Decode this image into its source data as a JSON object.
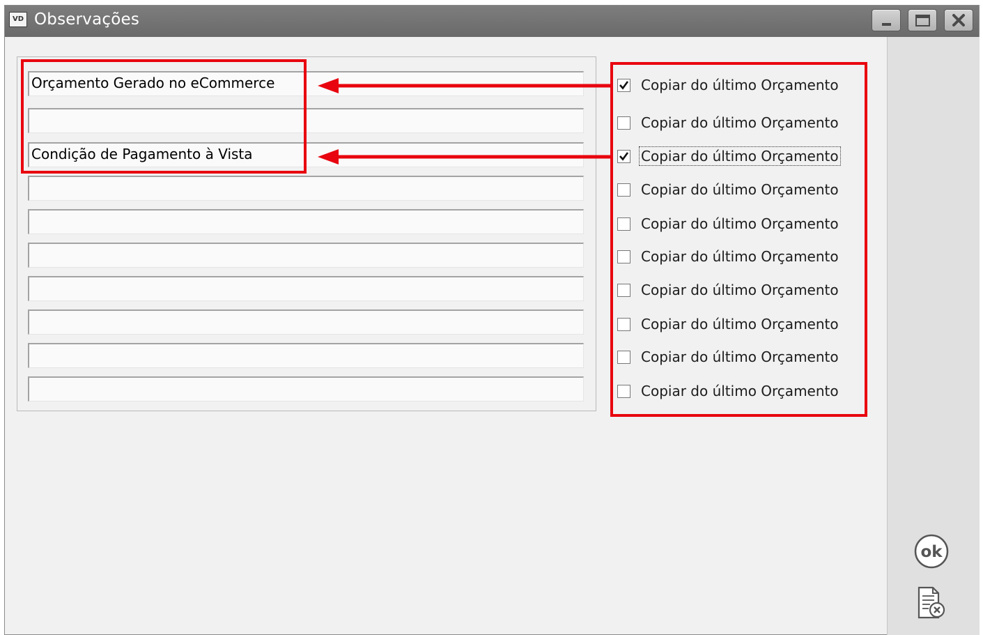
{
  "window": {
    "app_icon_text": "VD",
    "title": "Observações"
  },
  "titlebar_buttons": [
    {
      "name": "minimize-icon"
    },
    {
      "name": "maximize-icon"
    },
    {
      "name": "close-icon"
    }
  ],
  "observation_fields": [
    {
      "value": "Orçamento Gerado no eCommerce",
      "has_lookup_button": true
    },
    {
      "value": ""
    },
    {
      "value": "Condição de Pagamento à Vista"
    },
    {
      "value": ""
    },
    {
      "value": ""
    },
    {
      "value": ""
    },
    {
      "value": ""
    },
    {
      "value": ""
    },
    {
      "value": ""
    },
    {
      "value": ""
    }
  ],
  "lookup_button_label": "...",
  "copy_checkboxes": [
    {
      "label": "Copiar do último Orçamento",
      "checked": true
    },
    {
      "label": "Copiar do último Orçamento",
      "checked": false
    },
    {
      "label": "Copiar do último Orçamento",
      "checked": true,
      "focused": true
    },
    {
      "label": "Copiar do último Orçamento",
      "checked": false
    },
    {
      "label": "Copiar do último Orçamento",
      "checked": false
    },
    {
      "label": "Copiar do último Orçamento",
      "checked": false
    },
    {
      "label": "Copiar do último Orçamento",
      "checked": false
    },
    {
      "label": "Copiar do último Orçamento",
      "checked": false
    },
    {
      "label": "Copiar do último Orçamento",
      "checked": false
    },
    {
      "label": "Copiar do último Orçamento",
      "checked": false
    }
  ],
  "actions": {
    "ok_icon": "ok-icon",
    "ok_text": "ok",
    "cancel_icon": "document-cancel-icon"
  },
  "colors": {
    "annotation_red": "#e8050f",
    "titlebar": "#737373"
  }
}
